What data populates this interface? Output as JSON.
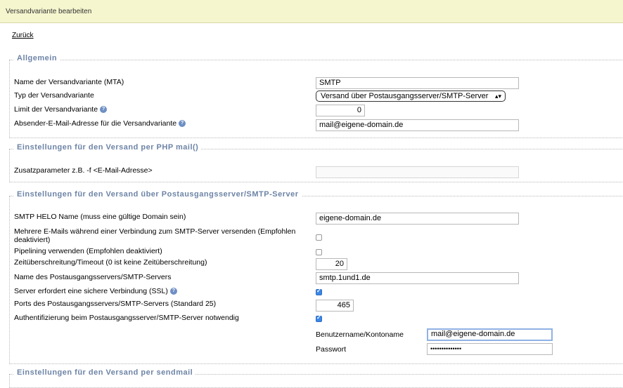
{
  "title": "Versandvariante bearbeiten",
  "back_link": "Zurück",
  "sections": {
    "general": {
      "legend": "Allgemein",
      "name_label": "Name der Versandvariante (MTA)",
      "name_value": "SMTP",
      "type_label": "Typ der Versandvariante",
      "type_value": "Versand über Postausgangsserver/SMTP-Server",
      "limit_label": "Limit der Versandvariante",
      "limit_value": "0",
      "sender_label": "Absender-E-Mail-Adresse für die Versandvariante",
      "sender_value": "mail@eigene-domain.de"
    },
    "php_mail": {
      "legend": "Einstellungen für den Versand per PHP mail()",
      "param_label": "Zusatzparameter z.B. -f <E-Mail-Adresse>",
      "param_value": ""
    },
    "smtp": {
      "legend": "Einstellungen für den Versand über Postausgangsserver/SMTP-Server",
      "helo_label": "SMTP HELO Name (muss eine gültige Domain sein)",
      "helo_value": "eigene-domain.de",
      "multi_label_1": "Mehrere E-Mails während einer Verbindung zum SMTP-Server versenden (Empfohlen",
      "multi_label_2": "deaktiviert)",
      "multi_checked": false,
      "pipelining_label": "Pipelining verwenden (Empfohlen deaktiviert)",
      "pipelining_checked": false,
      "timeout_label": "Zeitüberschreitung/Timeout (0 ist keine Zeitüberschreitung)",
      "timeout_value": "20",
      "server_label": "Name des Postausgangsservers/SMTP-Servers",
      "server_value": "smtp.1und1.de",
      "ssl_label": "Server erfordert eine sichere Verbindung (SSL)",
      "ssl_checked": true,
      "port_label": "Ports des Postausgangsservers/SMTP-Servers (Standard 25)",
      "port_value": "465",
      "auth_label": "Authentifizierung beim Postausgangsserver/SMTP-Server notwendig",
      "auth_checked": true,
      "user_label": "Benutzername/Kontoname",
      "user_value": "mail@eigene-domain.de",
      "password_label": "Passwort",
      "password_value": "••••••••••••••"
    },
    "sendmail": {
      "legend": "Einstellungen für den Versand per sendmail"
    }
  },
  "help_icon_glyph": "?"
}
